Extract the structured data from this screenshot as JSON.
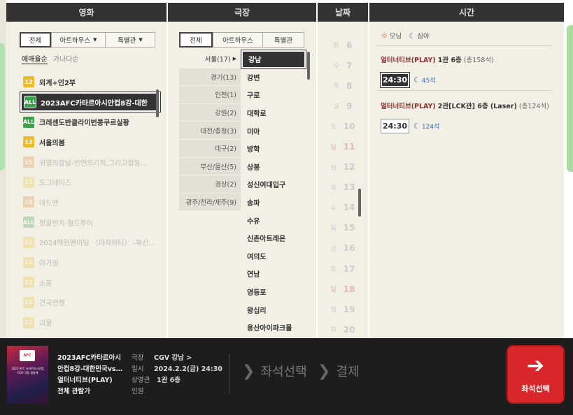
{
  "headers": {
    "movie": "영화",
    "theater": "극장",
    "date": "날짜",
    "time": "시간"
  },
  "movie_filters": {
    "tabs": [
      "전체",
      "아트하우스",
      "특별관"
    ],
    "sort": [
      "예매율순",
      "가나다순"
    ]
  },
  "movies": [
    {
      "rating": "12",
      "rating_color": "#edbc2d",
      "title": "외계+인2부",
      "state": "normal"
    },
    {
      "rating": "ALL",
      "rating_color": "#3aa04a",
      "title": "2023AFC카타르아시안컵8강-대한",
      "state": "selected"
    },
    {
      "rating": "ALL",
      "rating_color": "#3aa04a",
      "title": "크레센도반클라이번콩쿠르실황",
      "state": "normal"
    },
    {
      "rating": "12",
      "rating_color": "#edbc2d",
      "title": "서울의봄",
      "state": "normal"
    },
    {
      "rating": "15",
      "rating_color": "#e4822c",
      "title": "귀멸의칼날-인연의기적,그리고합동…",
      "state": "dim"
    },
    {
      "rating": "12",
      "rating_color": "#edbc2d",
      "title": "도그데이즈",
      "state": "dim"
    },
    {
      "rating": "15",
      "rating_color": "#e4822c",
      "title": "데드맨",
      "state": "dim"
    },
    {
      "rating": "ALL",
      "rating_color": "#3aa04a",
      "title": "정글번치-월드투어",
      "state": "dim"
    },
    {
      "rating": "12",
      "rating_color": "#edbc2d",
      "title": "2024백현팬미팅 〈파자파티〉 -부산…",
      "state": "dim"
    },
    {
      "rating": "12",
      "rating_color": "#edbc2d",
      "title": "아가일",
      "state": "dim"
    },
    {
      "rating": "12",
      "rating_color": "#edbc2d",
      "title": "소풍",
      "state": "dim"
    },
    {
      "rating": "12",
      "rating_color": "#edbc2d",
      "title": "건국전쟁",
      "state": "dim"
    },
    {
      "rating": "12",
      "rating_color": "#edbc2d",
      "title": "괴물",
      "state": "dim"
    }
  ],
  "theater_filters": {
    "tabs": [
      "전체",
      "아트하우스",
      "특별관"
    ]
  },
  "regions": [
    {
      "label": "서울(17)",
      "active": true
    },
    {
      "label": "경기(13)",
      "active": false
    },
    {
      "label": "인천(1)",
      "active": false
    },
    {
      "label": "강원(2)",
      "active": false
    },
    {
      "label": "대전/충청(3)",
      "active": false
    },
    {
      "label": "대구(2)",
      "active": false
    },
    {
      "label": "부산/울산(5)",
      "active": false
    },
    {
      "label": "경상(2)",
      "active": false
    },
    {
      "label": "광주/전라/제주(9)",
      "active": false
    }
  ],
  "theaters": [
    "강남",
    "강변",
    "구로",
    "대학로",
    "미아",
    "방학",
    "상봉",
    "성신여대입구",
    "송파",
    "수유",
    "신촌아트레온",
    "여의도",
    "연남",
    "영등포",
    "왕십리",
    "용산아이파크몰"
  ],
  "dates": [
    {
      "weekday": "화",
      "day": "6",
      "red": false
    },
    {
      "weekday": "수",
      "day": "7",
      "red": false
    },
    {
      "weekday": "목",
      "day": "8",
      "red": false
    },
    {
      "weekday": "금",
      "day": "9",
      "red": false
    },
    {
      "weekday": "토",
      "day": "10",
      "red": false
    },
    {
      "weekday": "일",
      "day": "11",
      "red": true
    },
    {
      "weekday": "월",
      "day": "12",
      "red": false
    },
    {
      "weekday": "화",
      "day": "13",
      "red": false
    },
    {
      "weekday": "수",
      "day": "14",
      "red": false
    },
    {
      "weekday": "목",
      "day": "15",
      "red": false
    },
    {
      "weekday": "금",
      "day": "16",
      "red": false
    },
    {
      "weekday": "토",
      "day": "17",
      "red": false
    },
    {
      "weekday": "일",
      "day": "18",
      "red": true
    },
    {
      "weekday": "월",
      "day": "19",
      "red": false
    },
    {
      "weekday": "화",
      "day": "20",
      "red": false
    }
  ],
  "time_legend": {
    "morning": "모닝",
    "night": "심야"
  },
  "showtimes": [
    {
      "brand": "얼터너티브(PLAY)",
      "screen": "1관 6층",
      "total": "(총158석)",
      "time": "24:30",
      "seats": "45석",
      "selected": true
    },
    {
      "brand": "얼터너티브(PLAY)",
      "screen": "2관[LCK관] 6층 (Laser)",
      "total": "(총124석)",
      "time": "24:30",
      "seats": "124석",
      "selected": false
    }
  ],
  "summary": {
    "poster_lines": [
      "2023 AFC 카타르아시안컵",
      "CGV 극장 생중계"
    ],
    "movie_lines": [
      "2023AFC카타르아시",
      "안컵8강-대한민국vs…",
      "얼터너티브(PLAY)",
      "전체 관람가"
    ],
    "details": [
      {
        "key": "극장",
        "value": "CGV 강남 >"
      },
      {
        "key": "일시",
        "value": "2024.2.2(금) 24:30"
      },
      {
        "key": "상영관",
        "value": "1관 6층"
      },
      {
        "key": "인원",
        "value": ""
      }
    ],
    "steps": [
      "좌석선택",
      "결제"
    ],
    "next_label": "좌석선택"
  }
}
